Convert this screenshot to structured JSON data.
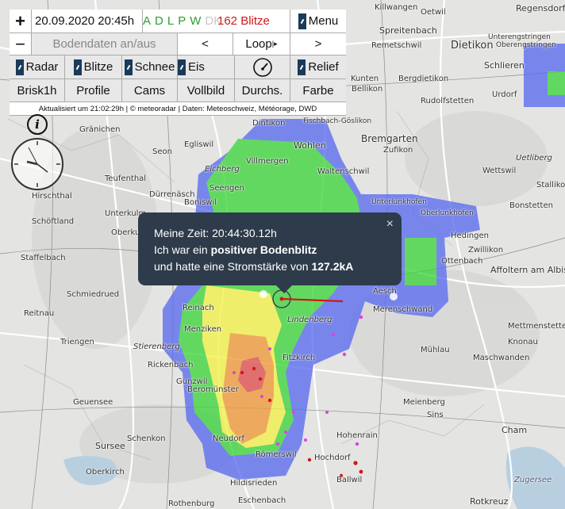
{
  "toolbar": {
    "zoom_in": "+",
    "zoom_out": "−",
    "datetime": "20.09.2020 20:45h",
    "networks": [
      {
        "label": "A",
        "color": "#2e9e2e"
      },
      {
        "label": "D",
        "color": "#2e9e2e"
      },
      {
        "label": "L",
        "color": "#2e9e2e"
      },
      {
        "label": "P",
        "color": "#2e9e2e"
      },
      {
        "label": "W",
        "color": "#2e9e2e"
      },
      {
        "label": "DK",
        "color": "#c8c8c8"
      }
    ],
    "strike_count": "162 Blitze",
    "menu": "Menu",
    "ground_data": "Bodendaten an/aus",
    "prev": "<",
    "loop": "Loop",
    "next": ">",
    "radar": "Radar",
    "blitze": "Blitze",
    "schnee": "Schnee",
    "eis": "Eis",
    "relief": "Relief",
    "brisk": "Brisk1h",
    "profile": "Profile",
    "cams": "Cams",
    "vollbild": "Vollbild",
    "durchs": "Durchs.",
    "farbe": "Farbe",
    "credits": "Aktualisiert um 21:02:29h | © meteoradar | Daten: Meteoschweiz, Météorage, DWD",
    "info": "i"
  },
  "popup": {
    "line1": "Meine Zeit: 20:44:30.12h",
    "line2_pre": "Ich war ein ",
    "line2_bold": "positiver Bodenblitz",
    "line3_pre": "und hatte eine Stromstärke von ",
    "line3_bold": "127.2kA",
    "close": "×"
  },
  "places": [
    "Killwangen",
    "Oetwil",
    "Regensdorf",
    "Spreitenbach",
    "Dietikon",
    "Remetschwil",
    "Unterengstringen",
    "Oberengstringen",
    "Kunten",
    "Bergdietikon",
    "Schlieren",
    "Bellikon",
    "Rudolfstetten",
    "Urdorf",
    "Fischbach-Göslikon",
    "Dintikon",
    "Bremgarten",
    "Zufikon",
    "Unterlunkhofen",
    "Oberlunkhofen",
    "Bonstetten",
    "Stallikon",
    "Wettswil",
    "Uetliberg",
    "Hedingen",
    "Wohlen",
    "Villmergen",
    "Waltenschwil",
    "Eichberg",
    "Seengen",
    "Boniswil",
    "Dürrenäsch",
    "Unterkulm",
    "Oberkulm",
    "Schöftland",
    "Hirschthal",
    "Gränichen",
    "Seon",
    "Egliswil",
    "Teufenthal",
    "Staffelbach",
    "Schmiedrued",
    "Reitnau",
    "Triengen",
    "Reinach",
    "Menziken",
    "Stierenberg",
    "Rickenbach",
    "Gunzwil",
    "Beromünster",
    "Neudorf",
    "Römerswil",
    "Hohenrain",
    "Hochdorf",
    "Ballwil",
    "Lindenberg",
    "Fitzkirch",
    "Merenschwand",
    "Aesch",
    "Mühlau",
    "Sins",
    "Meienberg",
    "Ottenbach",
    "Affoltern am Albis",
    "Zwillikon",
    "Mettmenstetten",
    "Knonau",
    "Maschwanden",
    "Geuensee",
    "Schenkon",
    "Sursee",
    "Oberkirch",
    "Hildisrieden",
    "Rothenburg",
    "Rotkreuz",
    "Cham",
    "Zugersee",
    "Eschenbach"
  ],
  "colors": {
    "accent": "#1a3a5a",
    "strike_red": "#d01818",
    "strike_pink": "#e040e0"
  }
}
